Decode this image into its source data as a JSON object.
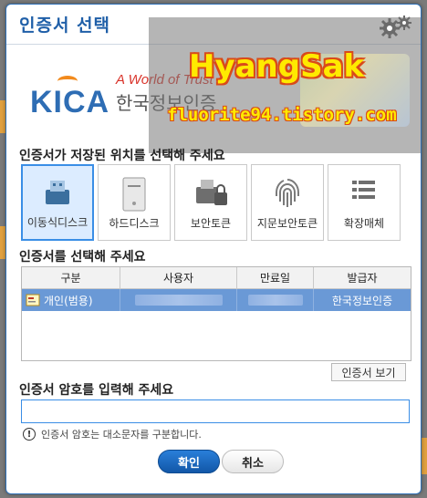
{
  "dialog": {
    "title": "인증서 선택"
  },
  "logo": {
    "brand": "KICA",
    "tagline": "A World of Trust",
    "korean_name": "한국정보인증"
  },
  "watermark": {
    "title": "HyangSak",
    "url": "fluorite94.tistory.com"
  },
  "locations": {
    "heading": "인증서가 저장된 위치를 선택해 주세요",
    "items": [
      {
        "label": "이동식디스크",
        "icon": "usb-drive-icon",
        "selected": true
      },
      {
        "label": "하드디스크",
        "icon": "hard-disk-icon",
        "selected": false
      },
      {
        "label": "보안토큰",
        "icon": "security-token-icon",
        "selected": false
      },
      {
        "label": "지문보안토큰",
        "icon": "fingerprint-icon",
        "selected": false
      },
      {
        "label": "확장매체",
        "icon": "list-icon",
        "selected": false
      }
    ]
  },
  "certificates": {
    "heading": "인증서를 선택해 주세요",
    "columns": [
      "구분",
      "사용자",
      "만료일",
      "발급자"
    ],
    "rows": [
      {
        "type": "개인(범용)",
        "user": "",
        "expiry": "",
        "issuer": "한국정보인증"
      }
    ],
    "view_button": "인증서 보기"
  },
  "password": {
    "heading": "인증서 암호를 입력해 주세요",
    "value": "",
    "hint": "인증서 암호는 대소문자를 구분합니다."
  },
  "buttons": {
    "ok": "확인",
    "cancel": "취소"
  },
  "colors": {
    "accent": "#1f5fa8",
    "selected_row": "#6a99d6",
    "selected_tile": "#dcecff"
  }
}
